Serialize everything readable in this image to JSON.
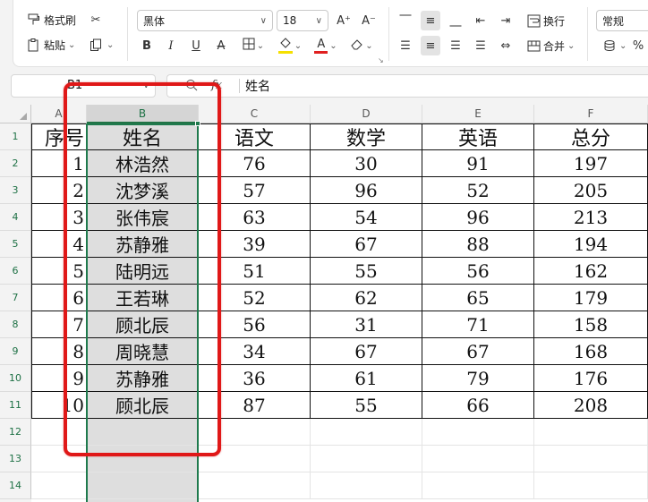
{
  "toolbar": {
    "format_painter": "格式刷",
    "paste": "粘贴",
    "font_name": "黑体",
    "font_size": "18",
    "wrap_text": "换行",
    "merge": "合并",
    "number_format": "常规",
    "bold": "B",
    "italic": "I",
    "underline": "U",
    "grow_font": "A⁺",
    "shrink_font": "A⁻",
    "font_color_letter": "A",
    "percent": "%",
    "accent_color": "#217346",
    "highlight_color": "#f5e000",
    "font_color": "#e02020"
  },
  "formula_bar": {
    "name_box": "B1",
    "fx_label": "fx",
    "value": "姓名"
  },
  "columns": [
    "A",
    "B",
    "C",
    "D",
    "E",
    "F"
  ],
  "rows": [
    "1",
    "2",
    "3",
    "4",
    "5",
    "6",
    "7",
    "8",
    "9",
    "10",
    "11",
    "12",
    "13",
    "14"
  ],
  "sheet": {
    "headers": [
      "序号",
      "姓名",
      "语文",
      "数学",
      "英语",
      "总分"
    ],
    "records": [
      [
        "1",
        "林浩然",
        "76",
        "30",
        "91",
        "197"
      ],
      [
        "2",
        "沈梦溪",
        "57",
        "96",
        "52",
        "205"
      ],
      [
        "3",
        "张伟宸",
        "63",
        "54",
        "96",
        "213"
      ],
      [
        "4",
        "苏静雅",
        "39",
        "67",
        "88",
        "194"
      ],
      [
        "5",
        "陆明远",
        "51",
        "55",
        "56",
        "162"
      ],
      [
        "6",
        "王若琳",
        "52",
        "62",
        "65",
        "179"
      ],
      [
        "7",
        "顾北辰",
        "56",
        "31",
        "71",
        "158"
      ],
      [
        "8",
        "周晓慧",
        "34",
        "67",
        "67",
        "168"
      ],
      [
        "9",
        "苏静雅",
        "36",
        "61",
        "79",
        "176"
      ],
      [
        "10",
        "顾北辰",
        "87",
        "55",
        "66",
        "208"
      ]
    ]
  },
  "selection": {
    "column": "B",
    "annotation_color": "#e01818"
  }
}
